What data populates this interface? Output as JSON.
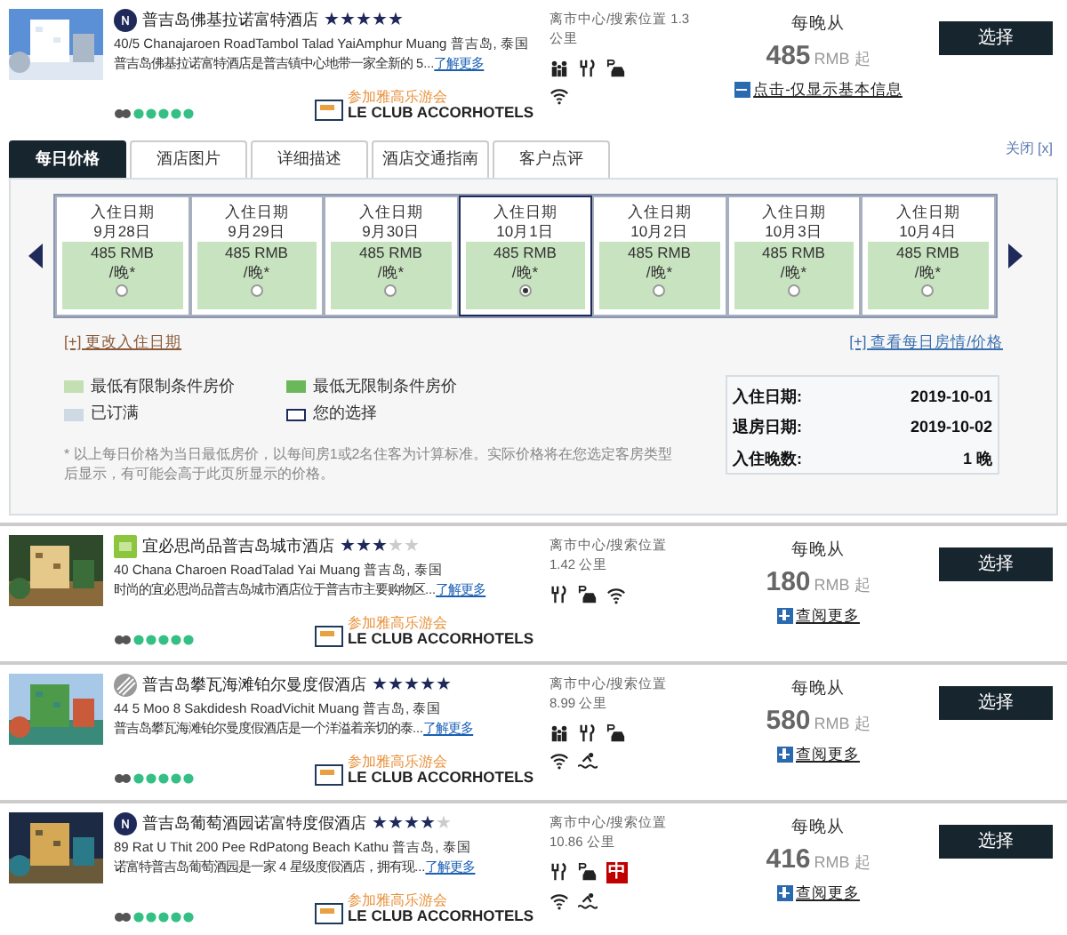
{
  "hotels": [
    {
      "logo": {
        "kind": "circle"
      },
      "name": "普吉岛佛基拉诺富特酒店",
      "stars": 5,
      "address": "40/5 Chanajaroen RoadTambol Talad YaiAmphur Muang 普吉岛, 泰国",
      "description": "普吉岛佛基拉诺富特酒店是普吉镇中心地带一家全新的 5...",
      "more_link": "了解更多",
      "club_promo": "参加雅高乐游会",
      "club_name": "LE CLUB ACCORHOTELS",
      "distance": "离市中心/搜索位置 1.3 公里",
      "amenities": [
        {
          "kind": "family"
        },
        {
          "kind": "restaurant"
        },
        {
          "kind": "parking"
        },
        {
          "kind": "wifi"
        }
      ],
      "price_label": "每晚从",
      "price": "485",
      "currency": "RMB 起",
      "toggle": {
        "text": "点击-仅显示基本信息",
        "expanded": true
      },
      "select": "选择"
    },
    {
      "logo": {
        "kind": "square"
      },
      "name": "宜必思尚品普吉岛城市酒店",
      "stars": 3,
      "address": "40 Chana Charoen RoadTalad Yai Muang 普吉岛, 泰国",
      "description": "时尚的宜必思尚品普吉岛城市酒店位于普吉市主要购物区...",
      "more_link": "了解更多",
      "club_promo": "参加雅高乐游会",
      "club_name": "LE CLUB ACCORHOTELS",
      "distance": "离市中心/搜索位置 1.42 公里",
      "amenities": [
        {
          "kind": "restaurant"
        },
        {
          "kind": "parking"
        },
        {
          "kind": "wifi"
        }
      ],
      "price_label": "每晚从",
      "price": "180",
      "currency": "RMB 起",
      "toggle": {
        "text": "查阅更多",
        "expanded": false
      },
      "select": "选择"
    },
    {
      "logo": {
        "kind": "striped"
      },
      "name": "普吉岛攀瓦海滩铂尔曼度假酒店",
      "stars": 5,
      "address": "44 5 Moo 8 Sakdidesh RoadVichit Muang 普吉岛, 泰国",
      "description": "普吉岛攀瓦海滩铂尔曼度假酒店是一个洋溢着亲切的泰...",
      "more_link": "了解更多",
      "club_promo": "参加雅高乐游会",
      "club_name": "LE CLUB ACCORHOTELS",
      "distance": "离市中心/搜索位置 8.99 公里",
      "amenities": [
        {
          "kind": "family"
        },
        {
          "kind": "restaurant"
        },
        {
          "kind": "parking"
        },
        {
          "kind": "wifi"
        },
        {
          "kind": "pool"
        }
      ],
      "price_label": "每晚从",
      "price": "580",
      "currency": "RMB 起",
      "toggle": {
        "text": "查阅更多",
        "expanded": false
      },
      "select": "选择"
    },
    {
      "logo": {
        "kind": "circle"
      },
      "name": "普吉岛葡萄酒园诺富特度假酒店",
      "stars": 4,
      "address": "89 Rat U Thit 200 Pee RdPatong Beach Kathu 普吉岛, 泰国",
      "description": "诺富特普吉岛葡萄酒园是一家 4 星级度假酒店，拥有现...",
      "more_link": "了解更多",
      "club_promo": "参加雅高乐游会",
      "club_name": "LE CLUB ACCORHOTELS",
      "distance": "离市中心/搜索位置 10.86 公里",
      "amenities": [
        {
          "kind": "restaurant"
        },
        {
          "kind": "parking"
        },
        {
          "kind": "badge",
          "label": "中"
        },
        {
          "kind": "wifi"
        },
        {
          "kind": "pool"
        }
      ],
      "price_label": "每晚从",
      "price": "416",
      "currency": "RMB 起",
      "toggle": {
        "text": "查阅更多",
        "expanded": false
      },
      "select": "选择"
    }
  ],
  "panel": {
    "close": "关闭 [x]",
    "tabs": [
      {
        "label": "每日价格",
        "selected": true
      },
      {
        "label": "酒店图片",
        "selected": false
      },
      {
        "label": "详细描述",
        "selected": false
      },
      {
        "label": "酒店交通指南",
        "selected": false
      },
      {
        "label": "客户点评",
        "selected": false
      }
    ],
    "days": [
      {
        "label": "入住日期",
        "date": "9月28日",
        "price": "485 RMB",
        "unit": "/晚*",
        "selected": false
      },
      {
        "label": "入住日期",
        "date": "9月29日",
        "price": "485 RMB",
        "unit": "/晚*",
        "selected": false
      },
      {
        "label": "入住日期",
        "date": "9月30日",
        "price": "485 RMB",
        "unit": "/晚*",
        "selected": false
      },
      {
        "label": "入住日期",
        "date": "10月1日",
        "price": "485 RMB",
        "unit": "/晚*",
        "selected": true
      },
      {
        "label": "入住日期",
        "date": "10月2日",
        "price": "485 RMB",
        "unit": "/晚*",
        "selected": false
      },
      {
        "label": "入住日期",
        "date": "10月3日",
        "price": "485 RMB",
        "unit": "/晚*",
        "selected": false
      },
      {
        "label": "入住日期",
        "date": "10月4日",
        "price": "485 RMB",
        "unit": "/晚*",
        "selected": false
      }
    ],
    "change_link": "[+] 更改入住日期",
    "calendar_link": "[+] 查看每日房情/价格",
    "legend": [
      {
        "kind": "limited",
        "label": "最低有限制条件房价"
      },
      {
        "kind": "unlimited",
        "label": "最低无限制条件房价"
      },
      {
        "kind": "booked",
        "label": "已订满"
      },
      {
        "kind": "choice",
        "label": "您的选择"
      }
    ],
    "note": "* 以上每日价格为当日最低房价，以每间房1或2名住客为计算标准。实际价格将在您选定客房类型后显示，有可能会高于此页所显示的价格。",
    "summary": [
      {
        "label": "入住日期:",
        "value": "2019-10-01"
      },
      {
        "label": "退房日期:",
        "value": "2019-10-02"
      },
      {
        "label": "入住晚数:",
        "value": "1 晚"
      }
    ]
  }
}
